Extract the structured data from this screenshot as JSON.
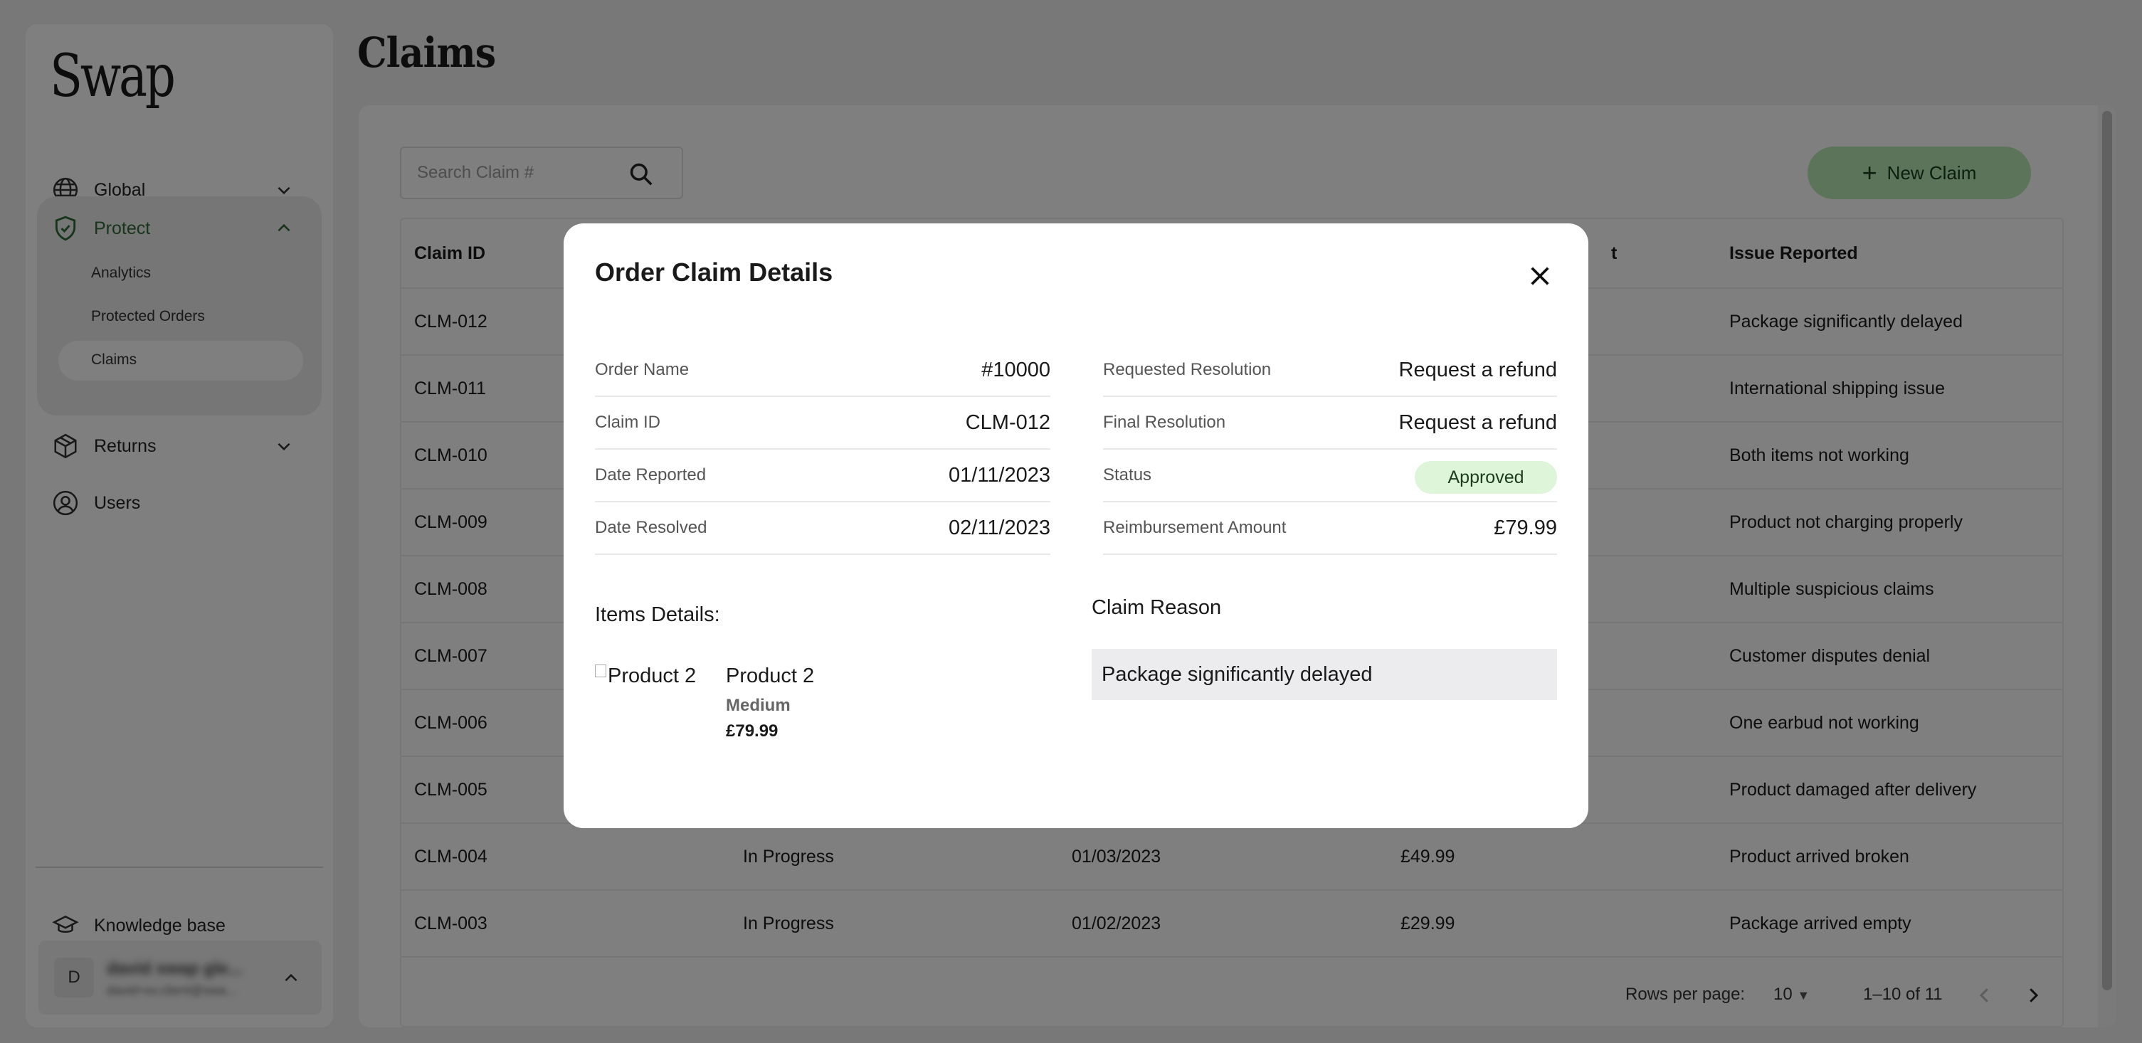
{
  "sidebar": {
    "logo": "Swap",
    "nav": {
      "global": "Global",
      "protect": "Protect",
      "returns": "Returns",
      "users": "Users"
    },
    "protect_sub": [
      "Analytics",
      "Protected Orders",
      "Claims"
    ],
    "knowledge_base": "Knowledge base",
    "user": {
      "initial": "D",
      "name": "david swap gle...",
      "email": "david+sv.client@swa..."
    }
  },
  "page": {
    "title": "Claims"
  },
  "toolbar": {
    "search_placeholder": "Search Claim #",
    "new_claim_label": "New Claim"
  },
  "table": {
    "headers": [
      "Claim ID",
      "",
      "",
      "",
      "Issue Reported"
    ],
    "header_partial": "t",
    "rows": [
      [
        "CLM-012",
        "",
        "",
        "",
        "Package significantly delayed"
      ],
      [
        "CLM-011",
        "",
        "",
        "",
        "International shipping issue"
      ],
      [
        "CLM-010",
        "",
        "",
        "",
        "Both items not working"
      ],
      [
        "CLM-009",
        "",
        "",
        "",
        "Product not charging properly"
      ],
      [
        "CLM-008",
        "",
        "",
        "",
        "Multiple suspicious claims"
      ],
      [
        "CLM-007",
        "",
        "",
        "",
        "Customer disputes denial"
      ],
      [
        "CLM-006",
        "",
        "",
        "",
        "One earbud not working"
      ],
      [
        "CLM-005",
        "",
        "",
        "",
        "Product damaged after delivery"
      ],
      [
        "CLM-004",
        "In Progress",
        "01/03/2023",
        "£49.99",
        "Product arrived broken"
      ],
      [
        "CLM-003",
        "In Progress",
        "01/02/2023",
        "£29.99",
        "Package arrived empty"
      ]
    ]
  },
  "pagination": {
    "rows_per_page_label": "Rows per page:",
    "rows_per_page": "10",
    "range": "1–10 of 11"
  },
  "modal": {
    "title": "Order Claim Details",
    "left": [
      {
        "label": "Order Name",
        "value": "#10000"
      },
      {
        "label": "Claim ID",
        "value": "CLM-012"
      },
      {
        "label": "Date Reported",
        "value": "01/11/2023"
      },
      {
        "label": "Date Resolved",
        "value": "02/11/2023"
      }
    ],
    "right": [
      {
        "label": "Requested Resolution",
        "value": "Request a refund"
      },
      {
        "label": "Final Resolution",
        "value": "Request a refund"
      },
      {
        "label": "Status",
        "value": "Approved"
      },
      {
        "label": "Reimbursement Amount",
        "value": "£79.99"
      }
    ],
    "items_label": "Items Details:",
    "item": {
      "image_alt": "Product 2",
      "name": "Product 2",
      "variant": "Medium",
      "price": "£79.99"
    },
    "claim_reason_label": "Claim Reason",
    "claim_reason": "Package significantly delayed"
  },
  "colors": {
    "accent_green": "#2e6b34",
    "button_green": "#b9e8b2",
    "status_approved_bg": "#dff5da"
  }
}
